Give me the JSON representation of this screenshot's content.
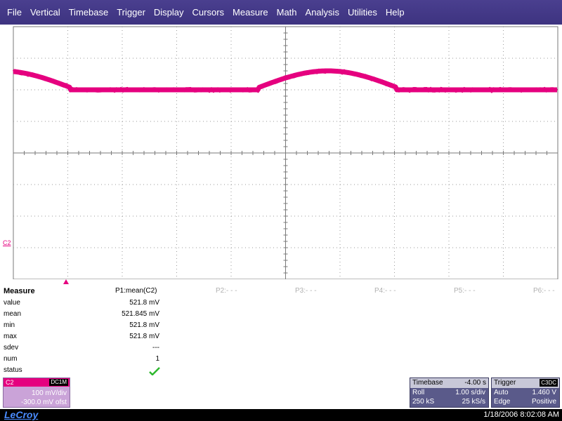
{
  "menu": [
    "File",
    "Vertical",
    "Timebase",
    "Trigger",
    "Display",
    "Cursors",
    "Measure",
    "Math",
    "Analysis",
    "Utilities",
    "Help"
  ],
  "channel_label": "C2",
  "measure": {
    "title": "Measure",
    "rows": [
      "value",
      "mean",
      "min",
      "max",
      "sdev",
      "num",
      "status"
    ],
    "p1_header": "P1:mean(C2)",
    "p1_values": [
      "521.8 mV",
      "521.845 mV",
      "521.8 mV",
      "521.8 mV",
      "---",
      "1"
    ],
    "other_headers": [
      "P2:- - -",
      "P3:- - -",
      "P4:- - -",
      "P5:- - -",
      "P6:- - -"
    ]
  },
  "c2_panel": {
    "name": "C2",
    "coupling": "DC1M",
    "vdiv": "100 mV/div",
    "offset": "-300.0 mV ofst"
  },
  "timebase": {
    "title": "Timebase",
    "delay": "-4.00 s",
    "mode": "Roll",
    "tdiv": "1.00 s/div",
    "samples": "250 kS",
    "rate": "25 kS/s"
  },
  "trigger": {
    "title": "Trigger",
    "channel": "C3DC",
    "mode": "Auto",
    "level": "1.460 V",
    "type": "Edge",
    "slope": "Positive"
  },
  "statusbar": {
    "logo": "LeCroy",
    "datetime": "1/18/2006 8:02:08 AM"
  },
  "colors": {
    "trace": "#e5007f",
    "menubar": "#3d3380",
    "panel": "#5a5a8a"
  }
}
